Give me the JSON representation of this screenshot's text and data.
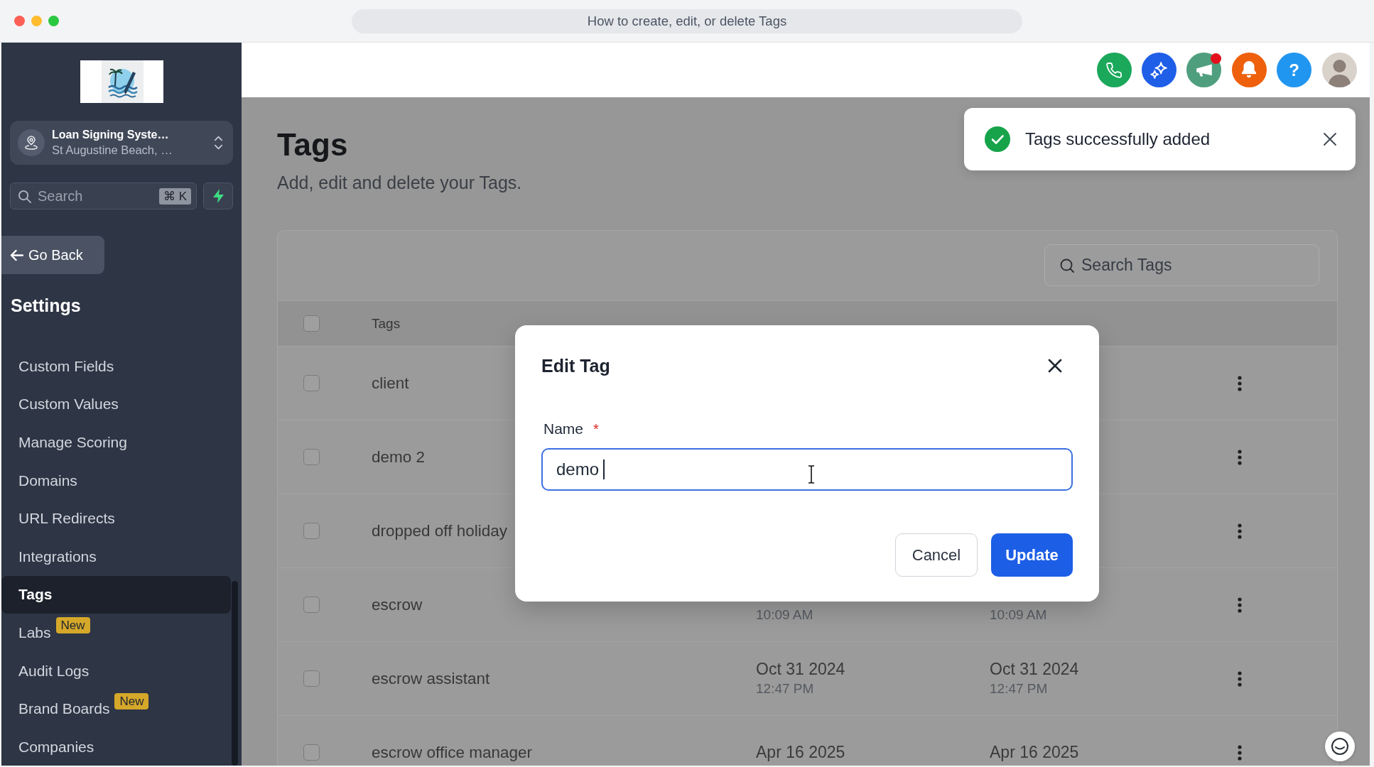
{
  "window": {
    "title": "How to create, edit, or delete Tags"
  },
  "sidebar": {
    "account": {
      "name": "Loan Signing Syste…",
      "location": "St Augustine Beach, …"
    },
    "search": {
      "placeholder": "Search",
      "shortcut": "⌘ K"
    },
    "back_button": "Go Back",
    "section_title": "Settings",
    "items": [
      {
        "label": "Custom Fields",
        "selected": false
      },
      {
        "label": "Custom Values",
        "selected": false
      },
      {
        "label": "Manage Scoring",
        "selected": false
      },
      {
        "label": "Domains",
        "selected": false
      },
      {
        "label": "URL Redirects",
        "selected": false
      },
      {
        "label": "Integrations",
        "selected": false
      },
      {
        "label": "Tags",
        "selected": true
      },
      {
        "label": "Labs",
        "selected": false,
        "badge": "New"
      },
      {
        "label": "Audit Logs",
        "selected": false
      },
      {
        "label": "Brand Boards",
        "selected": false,
        "badge": "New"
      },
      {
        "label": "Companies",
        "selected": false
      }
    ]
  },
  "header": {
    "actions": [
      {
        "kind": "phone",
        "dot": false
      },
      {
        "kind": "sparkles",
        "dot": false
      },
      {
        "kind": "megaphone",
        "dot": true
      },
      {
        "kind": "bell",
        "dot": false
      },
      {
        "kind": "help",
        "label": "?",
        "dot": false
      },
      {
        "kind": "avatar",
        "dot": false
      }
    ]
  },
  "toast": {
    "message": "Tags successfully added"
  },
  "page": {
    "title": "Tags",
    "subtitle": "Add, edit and delete your Tags."
  },
  "table": {
    "search": {
      "placeholder": "Search Tags"
    },
    "all_checked": false,
    "columns": [
      "Tags"
    ],
    "rows": [
      {
        "name": "client",
        "checked": false
      },
      {
        "name": "demo 2",
        "checked": false
      },
      {
        "name": "dropped off holiday",
        "checked": false
      },
      {
        "name": "escrow",
        "checked": false,
        "created": {
          "time": "10:09 AM"
        },
        "updated": {
          "time": "10:09 AM"
        }
      },
      {
        "name": "escrow assistant",
        "checked": false,
        "created": {
          "date": "Oct 31 2024",
          "time": "12:47 PM"
        },
        "updated": {
          "date": "Oct 31 2024",
          "time": "12:47 PM"
        }
      },
      {
        "name": "escrow office manager",
        "checked": false,
        "created": {
          "date": "Apr 16 2025"
        },
        "updated": {
          "date": "Apr 16 2025"
        }
      }
    ]
  },
  "modal": {
    "title": "Edit Tag",
    "field": {
      "label": "Name",
      "required_mark": "*",
      "value": "demo"
    },
    "buttons": [
      {
        "label": "Cancel",
        "kind": "secondary"
      },
      {
        "label": "Update",
        "kind": "primary"
      }
    ]
  }
}
